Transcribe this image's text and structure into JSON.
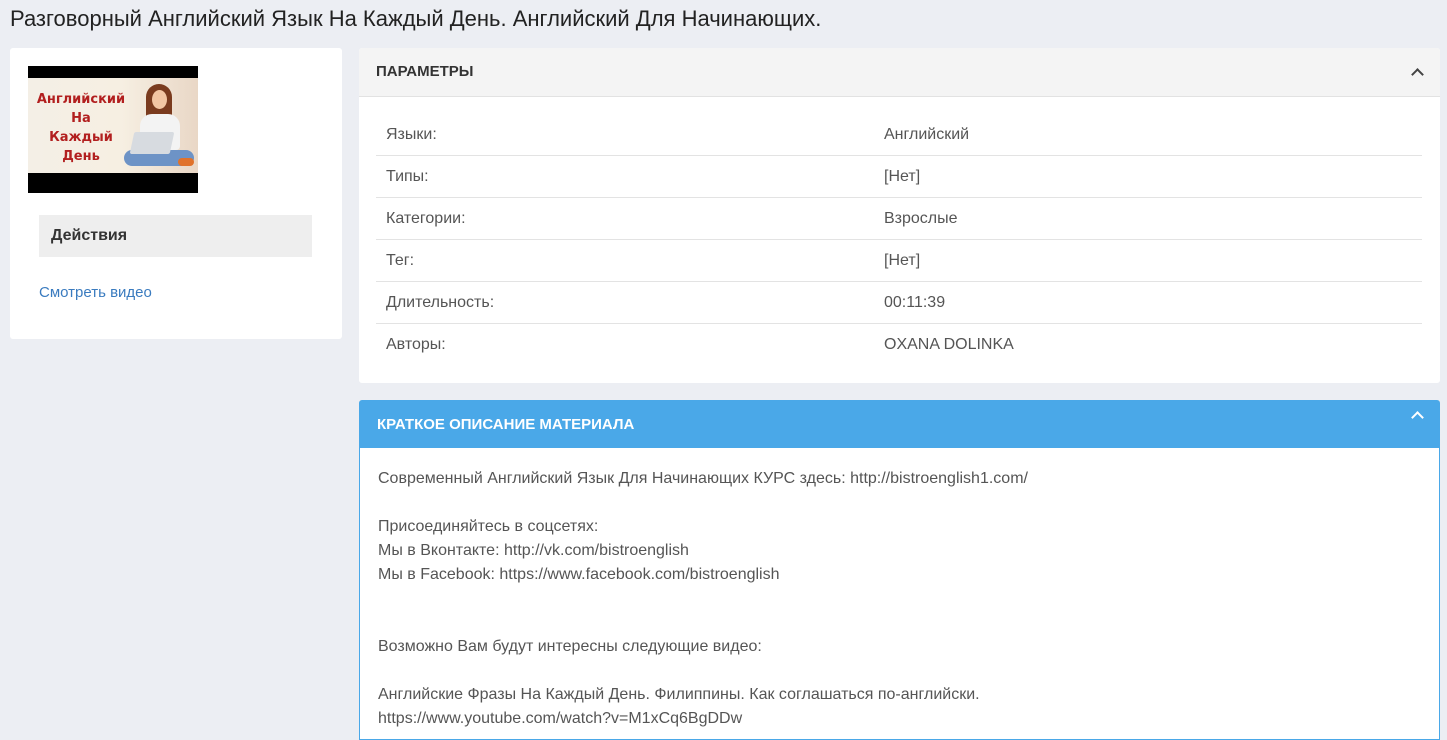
{
  "page": {
    "title": "Разговорный Английский Язык На Каждый День. Английский Для Начинающих."
  },
  "thumbnail": {
    "lines": [
      "Английский",
      "На",
      "Каждый",
      "День"
    ]
  },
  "actions": {
    "label": "Действия",
    "watch_video": "Смотреть видео"
  },
  "parameters": {
    "title": "ПАРАМЕТРЫ",
    "rows": [
      {
        "key": "Языки:",
        "value": "Английский"
      },
      {
        "key": "Типы:",
        "value": "[Нет]"
      },
      {
        "key": "Категории:",
        "value": "Взрослые"
      },
      {
        "key": "Тег:",
        "value": "[Нет]"
      },
      {
        "key": "Длительность:",
        "value": "00:11:39"
      },
      {
        "key": "Авторы:",
        "value": "OXANA DOLINKA"
      }
    ]
  },
  "description": {
    "title": "КРАТКОЕ ОПИСАНИЕ МАТЕРИАЛА",
    "lines": [
      "Современный Английский Язык Для Начинающих КУРС здесь: http://bistroenglish1.com/",
      "Присоединяйтесь в соцсетях:",
      "Мы в Вконтакте: http://vk.com/bistroenglish",
      "Мы в Facebook: https://www.facebook.com/bistroenglish",
      "Возможно Вам будут интересны следующие видео:",
      "Английские Фразы На Каждый День. Филиппины. Как соглашаться по-английски.",
      "https://www.youtube.com/watch?v=M1xCq6BgDDw"
    ]
  },
  "colors": {
    "accent": "#4aa8e8",
    "link": "#3a7bbf",
    "background": "#eceef3"
  }
}
